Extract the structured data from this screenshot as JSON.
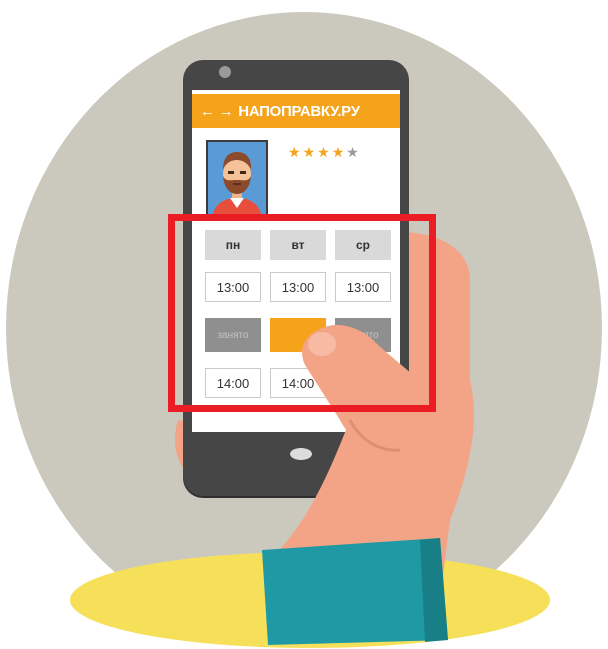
{
  "header": {
    "title": "НАПОПРАВКУ.РУ",
    "arrows": "← →"
  },
  "rating": {
    "value": 4,
    "max": 5
  },
  "schedule": {
    "days": [
      "пн",
      "вт",
      "ср"
    ],
    "row1_times": [
      "13:00",
      "13:00",
      "13:00"
    ],
    "row2_status": [
      "занято",
      "",
      "занято"
    ],
    "row3_times": [
      "14:00",
      "14:00",
      ""
    ]
  },
  "colors": {
    "accent": "#f5a31a",
    "highlight": "#ea1c24",
    "background_circle": "#cbc9bd",
    "floor": "#f6e05a",
    "sleeve": "#1f9aa4",
    "skin": "#f3a487"
  }
}
